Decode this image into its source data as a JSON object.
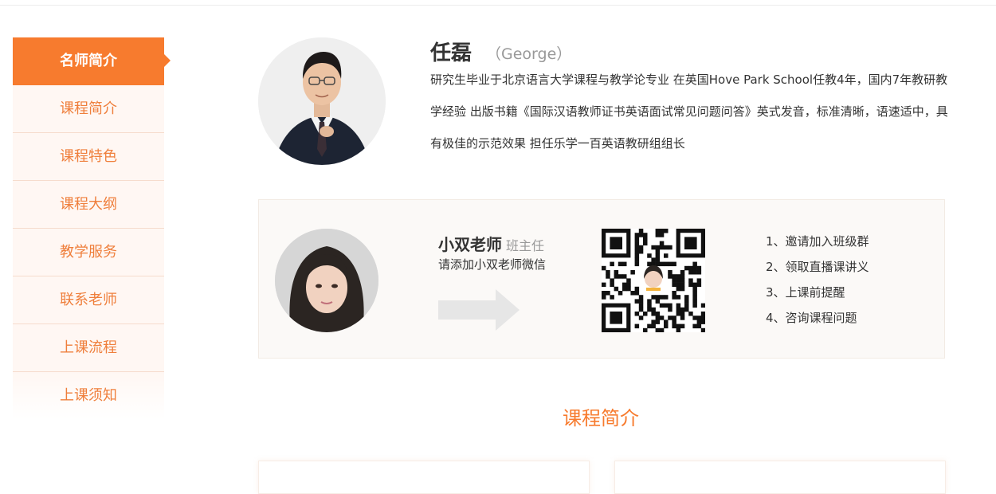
{
  "sidebar": {
    "items": [
      {
        "label": "名师简介",
        "active": true
      },
      {
        "label": "课程简介",
        "active": false
      },
      {
        "label": "课程特色",
        "active": false
      },
      {
        "label": "课程大纲",
        "active": false
      },
      {
        "label": "教学服务",
        "active": false
      },
      {
        "label": "联系老师",
        "active": false
      },
      {
        "label": "上课流程",
        "active": false
      },
      {
        "label": "上课须知",
        "active": false
      }
    ]
  },
  "teacher": {
    "name": "任磊",
    "english_name": "（George）",
    "bio": "研究生毕业于北京语言大学课程与教学论专业 在英国Hove Park School任教4年，国内7年教研教学经验 出版书籍《国际汉语教师证书英语面试常见问题问答》英式发音，标准清晰，语速适中，具有极佳的示范效果 担任乐学一百英语教研组组长"
  },
  "assistant": {
    "name": "小双老师",
    "role": "班主任",
    "tip": "请添加小双老师微信",
    "steps": [
      "1、邀请加入班级群",
      "2、领取直播课讲义",
      "3、上课前提醒",
      "4、咨询课程问题"
    ]
  },
  "section": {
    "title": "课程简介"
  },
  "colors": {
    "accent": "#f77b2e",
    "sidebar_bg": "#fff7f3",
    "card_bg": "#fbf9f7"
  }
}
